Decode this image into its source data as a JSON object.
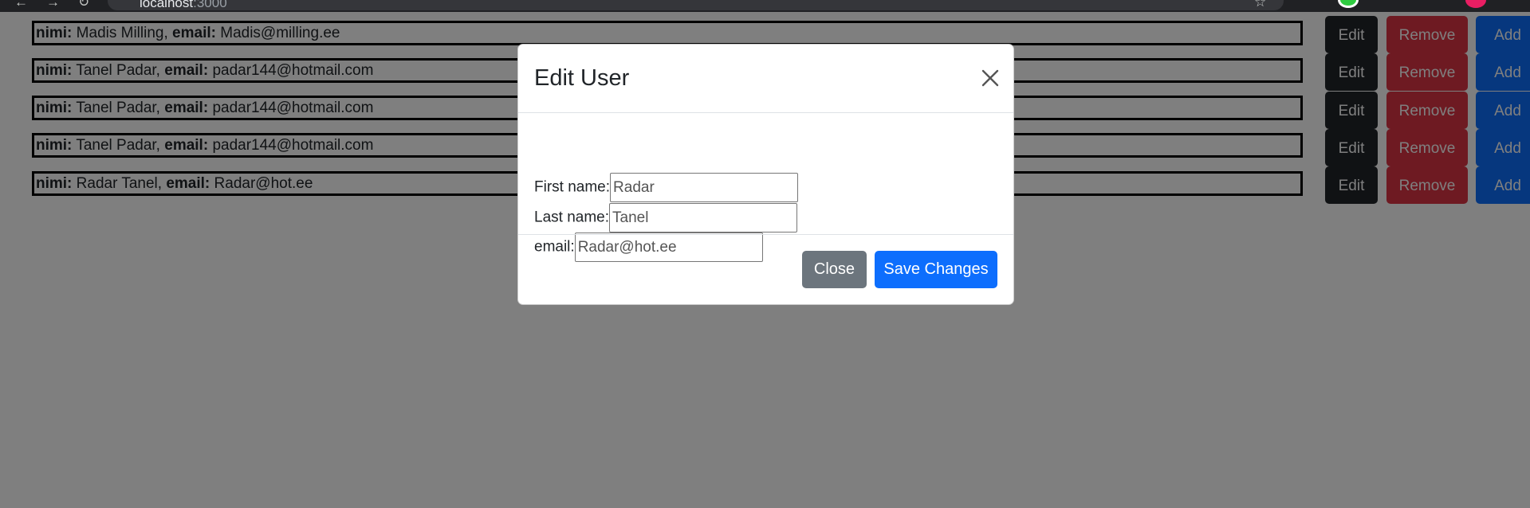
{
  "browser": {
    "url_host": "localhost",
    "url_port": ":3000"
  },
  "users": [
    {
      "name_label": "nimi:",
      "name": " Madis Milling, ",
      "email_label": "email:",
      "email": " Madis@milling.ee"
    },
    {
      "name_label": "nimi:",
      "name": " Tanel Padar, ",
      "email_label": "email:",
      "email": " padar144@hotmail.com"
    },
    {
      "name_label": "nimi:",
      "name": " Tanel Padar, ",
      "email_label": "email:",
      "email": " padar144@hotmail.com"
    },
    {
      "name_label": "nimi:",
      "name": " Tanel Padar, ",
      "email_label": "email:",
      "email": " padar144@hotmail.com"
    },
    {
      "name_label": "nimi:",
      "name": " Radar Tanel, ",
      "email_label": "email:",
      "email": " Radar@hot.ee"
    }
  ],
  "row_actions": {
    "edit": "Edit",
    "remove": "Remove",
    "add": "Add"
  },
  "modal": {
    "title": "Edit User",
    "first_name_label": "First name:",
    "first_name_value": "Radar",
    "last_name_label": "Last name:",
    "last_name_value": "Tanel",
    "email_label": "email:",
    "email_value": "Radar@hot.ee",
    "close_label": "Close",
    "save_label": "Save Changes"
  },
  "colors": {
    "edit": "#212529",
    "remove": "#dc3545",
    "add": "#0d6efd",
    "close_button": "#6c757d",
    "save_button": "#0d6efd",
    "backdrop": "rgba(0,0,0,0.5)"
  },
  "icons": {
    "modal_close": "close-icon",
    "back": "back-arrow-icon",
    "forward": "forward-arrow-icon",
    "reload": "reload-icon",
    "bookmark": "star-icon"
  }
}
